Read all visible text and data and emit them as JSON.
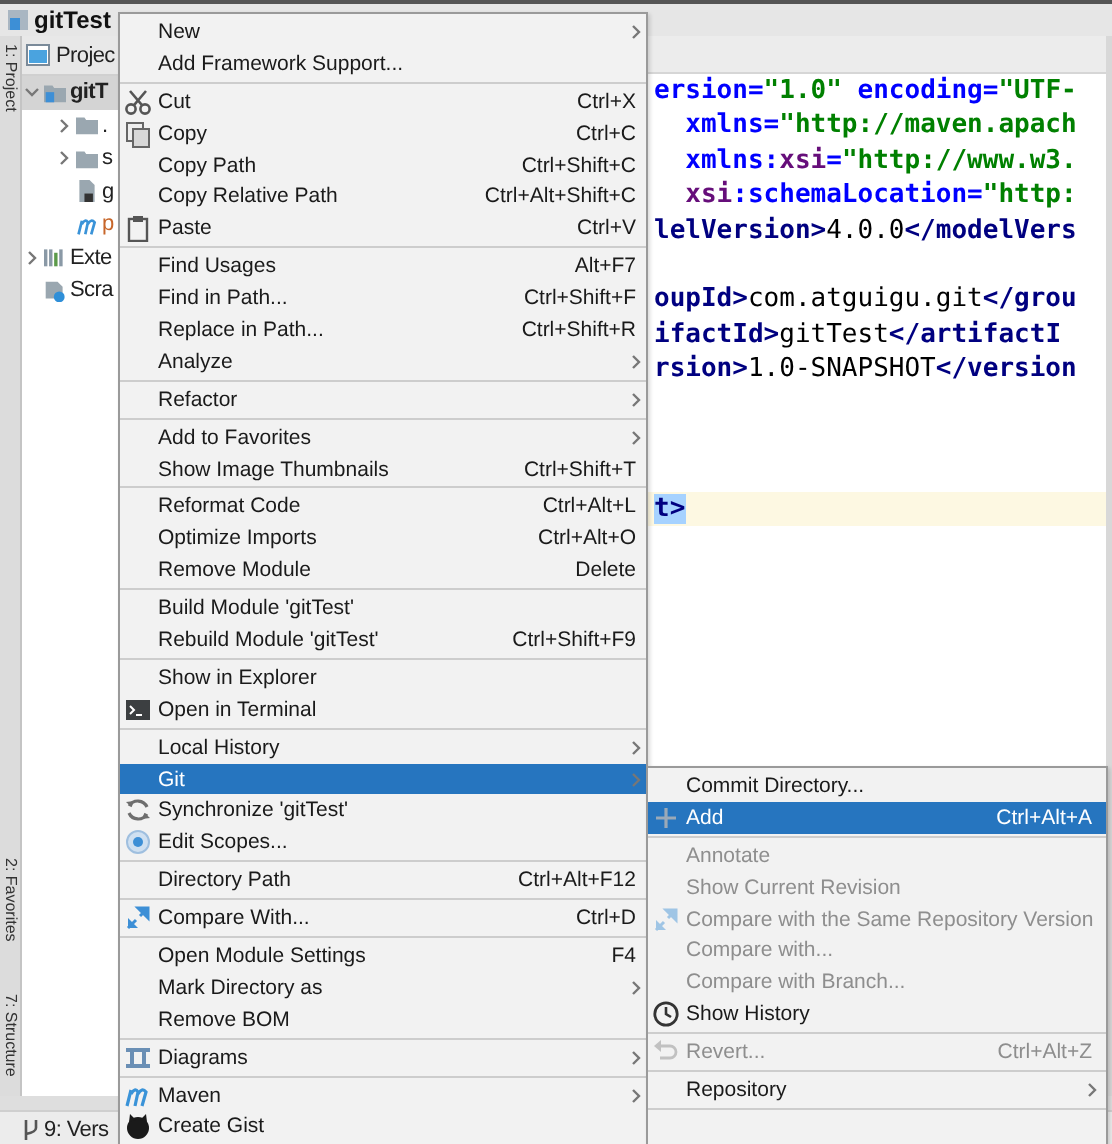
{
  "navigation_bar": {
    "project": "gitTest"
  },
  "side_tabs": [
    {
      "label": "1: Project"
    },
    {
      "label": "2: Favorites"
    },
    {
      "label": "7: Structure"
    }
  ],
  "project_panel": {
    "title": "Projec",
    "tree": [
      {
        "label": "gitT",
        "expanded": true,
        "selected": true,
        "children": [
          {
            "label": ".",
            "expanded": false,
            "selected": false
          },
          {
            "label": "s",
            "expanded": false,
            "selected": false
          },
          {
            "label": "g",
            "selected": false
          },
          {
            "label": "p",
            "selected": false,
            "color": "#c7662a"
          }
        ]
      },
      {
        "label": "Exte",
        "expanded": false,
        "selected": false
      },
      {
        "label": "Scra",
        "selected": false
      }
    ]
  },
  "bottom_tabs": [
    {
      "label": "9: Vers"
    }
  ],
  "editor": {
    "lines": [
      {
        "kind": "code",
        "current": false,
        "selected": false,
        "tokens": [
          {
            "kind": "attr",
            "text": "ersion="
          },
          {
            "kind": "value",
            "text": "\"1.0\""
          },
          {
            "kind": "attr",
            "text": " encoding="
          },
          {
            "kind": "value",
            "text": "\"UTF-"
          }
        ]
      },
      {
        "kind": "code",
        "current": false,
        "selected": false,
        "tokens": [
          {
            "kind": "attr",
            "text": "  xmlns="
          },
          {
            "kind": "value",
            "text": "\"http://maven.apach"
          }
        ]
      },
      {
        "kind": "code",
        "current": false,
        "selected": false,
        "tokens": [
          {
            "kind": "attr",
            "text": "  xmlns:"
          },
          {
            "kind": "ns",
            "text": "xsi"
          },
          {
            "kind": "attr",
            "text": "="
          },
          {
            "kind": "value",
            "text": "\"http://www.w3."
          }
        ]
      },
      {
        "kind": "code",
        "current": false,
        "selected": false,
        "tokens": [
          {
            "kind": "ns",
            "text": "  xsi"
          },
          {
            "kind": "attr",
            "text": ":schemaLocation="
          },
          {
            "kind": "value",
            "text": "\"http:"
          }
        ]
      },
      {
        "kind": "code",
        "current": false,
        "selected": false,
        "tokens": [
          {
            "kind": "tag",
            "text": "lelVersion>"
          },
          {
            "kind": "text",
            "text": "4.0.0"
          },
          {
            "kind": "tag",
            "text": "</modelVers"
          }
        ]
      },
      {
        "kind": "blank"
      },
      {
        "kind": "code",
        "current": false,
        "selected": false,
        "tokens": [
          {
            "kind": "tag",
            "text": "oupId>"
          },
          {
            "kind": "text",
            "text": "com.atguigu.git"
          },
          {
            "kind": "tag",
            "text": "</grou"
          }
        ]
      },
      {
        "kind": "code",
        "current": false,
        "selected": false,
        "tokens": [
          {
            "kind": "tag",
            "text": "ifactId>"
          },
          {
            "kind": "text",
            "text": "gitTest"
          },
          {
            "kind": "tag",
            "text": "</artifactI"
          }
        ]
      },
      {
        "kind": "code",
        "current": false,
        "selected": false,
        "tokens": [
          {
            "kind": "tag",
            "text": "rsion>"
          },
          {
            "kind": "text",
            "text": "1.0-SNAPSHOT"
          },
          {
            "kind": "tag",
            "text": "</version"
          }
        ]
      },
      {
        "kind": "blank"
      },
      {
        "kind": "blank"
      },
      {
        "kind": "blank"
      },
      {
        "kind": "code",
        "current": true,
        "selected": true,
        "tokens": [
          {
            "kind": "tag",
            "text": "t>"
          }
        ]
      }
    ]
  },
  "context_menu": {
    "items": [
      {
        "kind": "item",
        "label": "New",
        "submenu": true,
        "selected": false
      },
      {
        "kind": "item",
        "label": "Add Framework Support...",
        "selected": false
      },
      {
        "kind": "separator"
      },
      {
        "kind": "item",
        "label": "Cut",
        "shortcut": "Ctrl+X",
        "selected": false
      },
      {
        "kind": "item",
        "label": "Copy",
        "shortcut": "Ctrl+C",
        "selected": false
      },
      {
        "kind": "item",
        "label": "Copy Path",
        "shortcut": "Ctrl+Shift+C",
        "selected": false
      },
      {
        "kind": "item",
        "label": "Copy Relative Path",
        "shortcut": "Ctrl+Alt+Shift+C",
        "selected": false
      },
      {
        "kind": "item",
        "label": "Paste",
        "shortcut": "Ctrl+V",
        "selected": false
      },
      {
        "kind": "separator"
      },
      {
        "kind": "item",
        "label": "Find Usages",
        "shortcut": "Alt+F7",
        "selected": false
      },
      {
        "kind": "item",
        "label": "Find in Path...",
        "shortcut": "Ctrl+Shift+F",
        "selected": false
      },
      {
        "kind": "item",
        "label": "Replace in Path...",
        "shortcut": "Ctrl+Shift+R",
        "selected": false
      },
      {
        "kind": "item",
        "label": "Analyze",
        "submenu": true,
        "selected": false
      },
      {
        "kind": "separator"
      },
      {
        "kind": "item",
        "label": "Refactor",
        "submenu": true,
        "selected": false
      },
      {
        "kind": "separator"
      },
      {
        "kind": "item",
        "label": "Add to Favorites",
        "submenu": true,
        "selected": false
      },
      {
        "kind": "item",
        "label": "Show Image Thumbnails",
        "shortcut": "Ctrl+Shift+T",
        "selected": false
      },
      {
        "kind": "separator"
      },
      {
        "kind": "item",
        "label": "Reformat Code",
        "shortcut": "Ctrl+Alt+L",
        "selected": false
      },
      {
        "kind": "item",
        "label": "Optimize Imports",
        "shortcut": "Ctrl+Alt+O",
        "selected": false
      },
      {
        "kind": "item",
        "label": "Remove Module",
        "shortcut": "Delete",
        "selected": false
      },
      {
        "kind": "separator"
      },
      {
        "kind": "item",
        "label": "Build Module 'gitTest'",
        "selected": false
      },
      {
        "kind": "item",
        "label": "Rebuild Module 'gitTest'",
        "shortcut": "Ctrl+Shift+F9",
        "selected": false
      },
      {
        "kind": "separator"
      },
      {
        "kind": "item",
        "label": "Show in Explorer",
        "selected": false
      },
      {
        "kind": "item",
        "label": "Open in Terminal",
        "selected": false
      },
      {
        "kind": "separator"
      },
      {
        "kind": "item",
        "label": "Local History",
        "submenu": true,
        "selected": false
      },
      {
        "kind": "item",
        "label": "Git",
        "submenu": true,
        "selected": true
      },
      {
        "kind": "item",
        "label": "Synchronize 'gitTest'",
        "selected": false
      },
      {
        "kind": "item",
        "label": "Edit Scopes...",
        "selected": false
      },
      {
        "kind": "separator"
      },
      {
        "kind": "item",
        "label": "Directory Path",
        "shortcut": "Ctrl+Alt+F12",
        "selected": false
      },
      {
        "kind": "separator"
      },
      {
        "kind": "item",
        "label": "Compare With...",
        "shortcut": "Ctrl+D",
        "selected": false
      },
      {
        "kind": "separator"
      },
      {
        "kind": "item",
        "label": "Open Module Settings",
        "shortcut": "F4",
        "selected": false
      },
      {
        "kind": "item",
        "label": "Mark Directory as",
        "submenu": true,
        "selected": false
      },
      {
        "kind": "item",
        "label": "Remove BOM",
        "selected": false
      },
      {
        "kind": "separator"
      },
      {
        "kind": "item",
        "label": "Diagrams",
        "submenu": true,
        "selected": false
      },
      {
        "kind": "separator"
      },
      {
        "kind": "item",
        "label": "Maven",
        "submenu": true,
        "selected": false
      },
      {
        "kind": "item",
        "label": "Create Gist",
        "selected": false
      }
    ]
  },
  "git_submenu": {
    "items": [
      {
        "kind": "item",
        "label": "Commit Directory...",
        "selected": false,
        "disabled": false
      },
      {
        "kind": "item",
        "label": "Add",
        "shortcut": "Ctrl+Alt+A",
        "selected": true,
        "disabled": false
      },
      {
        "kind": "separator"
      },
      {
        "kind": "item",
        "label": "Annotate",
        "selected": false,
        "disabled": true
      },
      {
        "kind": "item",
        "label": "Show Current Revision",
        "selected": false,
        "disabled": true
      },
      {
        "kind": "item",
        "label": "Compare with the Same Repository Version",
        "selected": false,
        "disabled": true
      },
      {
        "kind": "item",
        "label": "Compare with...",
        "selected": false,
        "disabled": true
      },
      {
        "kind": "item",
        "label": "Compare with Branch...",
        "selected": false,
        "disabled": true
      },
      {
        "kind": "item",
        "label": "Show History",
        "selected": false,
        "disabled": false
      },
      {
        "kind": "separator"
      },
      {
        "kind": "item",
        "label": "Revert...",
        "shortcut": "Ctrl+Alt+Z",
        "selected": false,
        "disabled": true
      },
      {
        "kind": "separator"
      },
      {
        "kind": "item",
        "label": "Repository",
        "submenu": true,
        "selected": false,
        "disabled": false
      },
      {
        "kind": "separator"
      }
    ]
  }
}
